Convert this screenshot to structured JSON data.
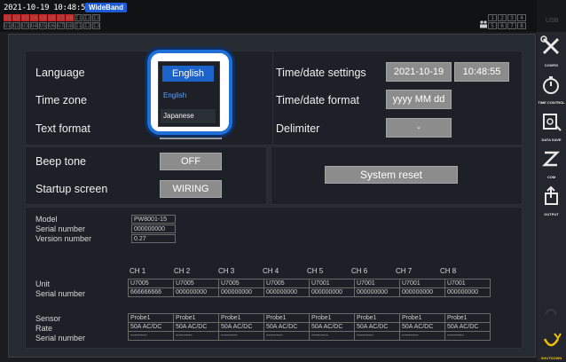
{
  "status": {
    "datetime": "2021-10-19 10:48:55",
    "wideband": "WideBand",
    "row1": [
      "U1",
      "U2",
      "U3",
      "U4",
      "U5",
      "U6",
      "U7",
      "U8",
      "I1",
      "I2",
      "I3"
    ],
    "row2": [
      "U1",
      "U2",
      "U3",
      "U4",
      "U5",
      "U6",
      "U7",
      "U8",
      "I1",
      "I2",
      "I3"
    ],
    "grid": [
      "1",
      "2",
      "3",
      "4",
      "5",
      "6",
      "7",
      "8"
    ]
  },
  "settings": {
    "language_label": "Language",
    "timezone_label": "Time zone",
    "textformat_label": "Text format",
    "timedate_label": "Time/date settings",
    "date_value": "2021-10-19",
    "time_value": "10:48:55",
    "timedate_format_label": "Time/date format",
    "timedate_format_value": "yyyy MM dd",
    "delimiter_label": "Delimiter",
    "delimiter_value": "-",
    "beep_label": "Beep tone",
    "beep_value": "OFF",
    "startup_label": "Startup screen",
    "startup_value": "WIRING",
    "reset_label": "System reset"
  },
  "dropdown": {
    "selected": "English",
    "options": [
      "English",
      "Japanese"
    ]
  },
  "info": {
    "model_label": "Model",
    "model_value": "PW8001-15",
    "serial_label": "Serial number",
    "serial_value": "000000000",
    "version_label": "Version number",
    "version_value": "0.27"
  },
  "channels": {
    "headers": [
      "CH 1",
      "CH 2",
      "CH 3",
      "CH 4",
      "CH 5",
      "CH 6",
      "CH 7",
      "CH 8"
    ],
    "unit_label": "Unit",
    "unit_serial_label": "Serial number",
    "units": [
      "U7005",
      "U7005",
      "U7005",
      "U7005",
      "U7001",
      "U7001",
      "U7001",
      "U7001"
    ],
    "unit_serials": [
      "666666666",
      "000000000",
      "000000000",
      "000000000",
      "000000000",
      "000000000",
      "000000000",
      "000000000"
    ],
    "sensor_label": "Sensor",
    "rate_label": "Rate",
    "sensor_serial_label": "Serial number",
    "sensors": [
      "Probe1",
      "Probe1",
      "Probe1",
      "Probe1",
      "Probe1",
      "Probe1",
      "Probe1",
      "Probe1"
    ],
    "rates": [
      "50A AC/DC",
      "50A AC/DC",
      "50A AC/DC",
      "50A AC/DC",
      "50A AC/DC",
      "50A AC/DC",
      "50A AC/DC",
      "50A AC/DC"
    ],
    "sensor_serials": [
      "--------",
      "--------",
      "--------",
      "--------",
      "--------",
      "--------",
      "--------",
      "--------"
    ]
  },
  "sidebar": {
    "top": "USB",
    "items": [
      "CONFIG",
      "TIME CONTROL",
      "DATA SAVE",
      "COM",
      "OUTPUT",
      "",
      "SHUTDOWN"
    ]
  },
  "colors": {
    "accent": "#1c63c9",
    "shutdown": "#f0c000"
  }
}
